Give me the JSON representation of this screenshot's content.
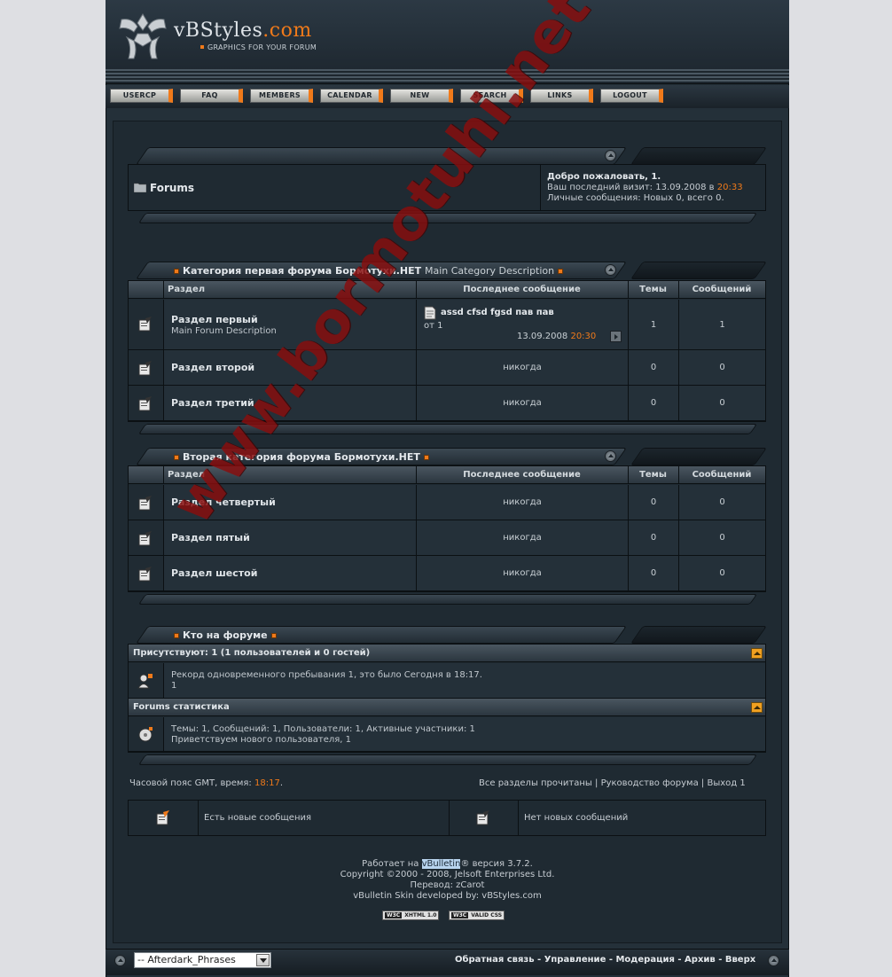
{
  "header": {
    "logo_text": "vBStyles",
    "logo_com": ".com",
    "logo_sub": "GRAPHICS FOR YOUR FORUM"
  },
  "nav": [
    "USERCP",
    "FAQ",
    "MEMBERS",
    "CALENDAR",
    "NEW",
    "SEARCH",
    "LINKS",
    "LOGOUT"
  ],
  "breadcrumb": {
    "title": "Forums",
    "welcome": "Добро пожаловать, 1.",
    "last_visit_label": "Ваш последний визит: 13.09.2008 в",
    "last_visit_time": "20:33",
    "pm": "Личные сообщения: Новых 0, всего 0."
  },
  "columns": {
    "forum": "Раздел",
    "last_post": "Последнее сообщение",
    "threads": "Темы",
    "posts": "Сообщений"
  },
  "categories": [
    {
      "title": "Категория первая форума Бормотухи.НЕТ",
      "description": "Main Category Description",
      "forums": [
        {
          "name": "Раздел первый",
          "description": "Main Forum Description",
          "last_post_title": "assd cfsd fgsd пав пав",
          "last_post_by": "от 1",
          "last_post_date": "13.09.2008",
          "last_post_time": "20:30",
          "threads": "1",
          "posts": "1"
        },
        {
          "name": "Раздел второй",
          "last_post": "никогда",
          "threads": "0",
          "posts": "0"
        },
        {
          "name": "Раздел третий",
          "last_post": "никогда",
          "threads": "0",
          "posts": "0"
        }
      ]
    },
    {
      "title": "Вторая категория форума Бормотухи.НЕТ",
      "forums": [
        {
          "name": "Раздел четвертый",
          "last_post": "никогда",
          "threads": "0",
          "posts": "0"
        },
        {
          "name": "Раздел пятый",
          "last_post": "никогда",
          "threads": "0",
          "posts": "0"
        },
        {
          "name": "Раздел шестой",
          "last_post": "никогда",
          "threads": "0",
          "posts": "0"
        }
      ]
    }
  ],
  "whos_online": {
    "title": "Кто на форуме",
    "present": "Присутствуют: 1 (1 пользователей и 0 гостей)",
    "record": "Рекорд одновременного пребывания 1, это было Сегодня в 18:17.",
    "users": "1",
    "stats_title": "Forums статистика",
    "stats": "Темы: 1, Сообщений: 1, Пользователи: 1, Активные участники: 1",
    "welcome_new": "Приветствуем нового пользователя, 1"
  },
  "footer_links": {
    "timezone_label": "Часовой пояс GMT, время:",
    "timezone_time": "18:17",
    "timezone_end": ".",
    "mark_read": "Все разделы прочитаны",
    "guide": "Руководство форума",
    "logout": "Выход 1",
    "sep": "|"
  },
  "legend": {
    "new_posts": "Есть новые сообщения",
    "no_new_posts": "Нет новых сообщений"
  },
  "copyright": {
    "powered_pre": "Работает на",
    "powered_link": "vBulletin",
    "powered_post": "® версия 3.7.2.",
    "copy": "Copyright ©2000 - 2008, Jelsoft Enterprises Ltd.",
    "translation": "Перевод: zCarot",
    "skin": "vBulletin Skin developed by: vBStyles.com",
    "badge1_w3c": "W3C",
    "badge1": "XHTML 1.0",
    "badge2_w3c": "W3C",
    "badge2": "VALID CSS"
  },
  "bottom_bar": {
    "style_select": "-- Afterdark_Phrases",
    "links": [
      "Обратная связь",
      "Управление",
      "Модерация",
      "Архив",
      "Вверх"
    ],
    "sep": "-"
  },
  "watermark": "www.bormotuhi.net"
}
